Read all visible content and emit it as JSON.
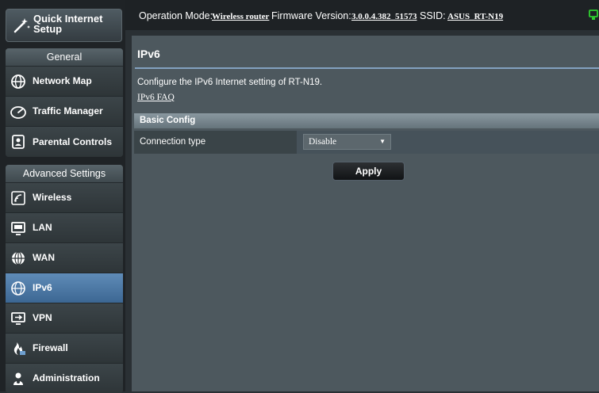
{
  "sidebar": {
    "quick_setup_label": "Quick Internet Setup",
    "general": {
      "title": "General",
      "items": [
        {
          "label": "Network Map",
          "icon": "network-map-icon"
        },
        {
          "label": "Traffic Manager",
          "icon": "traffic-manager-icon"
        },
        {
          "label": "Parental Controls",
          "icon": "parental-controls-icon"
        }
      ]
    },
    "advanced": {
      "title": "Advanced Settings",
      "items": [
        {
          "label": "Wireless",
          "icon": "wireless-icon"
        },
        {
          "label": "LAN",
          "icon": "lan-icon"
        },
        {
          "label": "WAN",
          "icon": "wan-icon"
        },
        {
          "label": "IPv6",
          "icon": "ipv6-icon",
          "active": true
        },
        {
          "label": "VPN",
          "icon": "vpn-icon"
        },
        {
          "label": "Firewall",
          "icon": "firewall-icon"
        },
        {
          "label": "Administration",
          "icon": "administration-icon"
        }
      ]
    }
  },
  "topbar": {
    "mode_label": "Operation Mode:",
    "mode_value": "Wireless router",
    "firmware_label": "Firmware Version:",
    "firmware_value": "3.0.0.4.382_51573",
    "ssid_label": "SSID:",
    "ssid_value": "ASUS_RT-N19"
  },
  "page": {
    "title": "IPv6",
    "description": "Configure the IPv6 Internet setting of RT-N19.",
    "faq_link": "IPv6 FAQ",
    "section": "Basic Config",
    "connection_type_label": "Connection type",
    "connection_type_value": "Disable",
    "apply_label": "Apply"
  },
  "colors": {
    "active_nav": "#4a78a8",
    "panel": "#4d585e",
    "status_icon": "#2fd12f"
  }
}
